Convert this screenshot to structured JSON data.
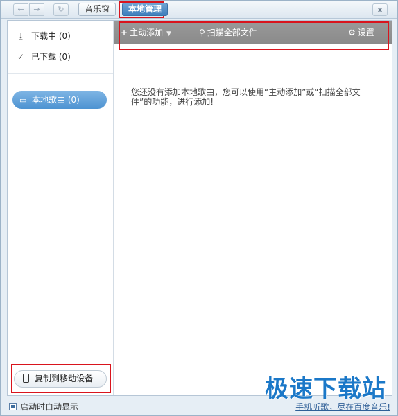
{
  "titlebar": {
    "nav_back_icon": "arrow-left-icon",
    "nav_forward_icon": "arrow-right-icon",
    "nav_refresh_icon": "refresh-icon",
    "tabs": [
      {
        "label": "音乐窗",
        "active": false
      },
      {
        "label": "本地管理",
        "active": true
      }
    ],
    "close_label": "x"
  },
  "sidebar": {
    "downloading": "下载中 (0)",
    "downloaded": "已下载 (0)",
    "local_songs": "本地歌曲 (0)",
    "copy_button": "复制到移动设备"
  },
  "toolbar": {
    "add_label": "主动添加",
    "scan_label": "扫描全部文件",
    "settings_label": "设置"
  },
  "main": {
    "empty_message": "您还没有添加本地歌曲，您可以使用“主动添加”或“扫描全部文件”的功能，进行添加!"
  },
  "statusbar": {
    "autostart_label": "启动时自动显示",
    "autostart_checked": true,
    "mobile_link": "手机听歌，尽在百度音乐!"
  },
  "watermark": "极速下载站",
  "colors": {
    "active_tab": "#4a88c7",
    "highlight_outline": "#d9141d",
    "toolbar_bg": "#909090",
    "selected_item": "#5a9bd6"
  }
}
